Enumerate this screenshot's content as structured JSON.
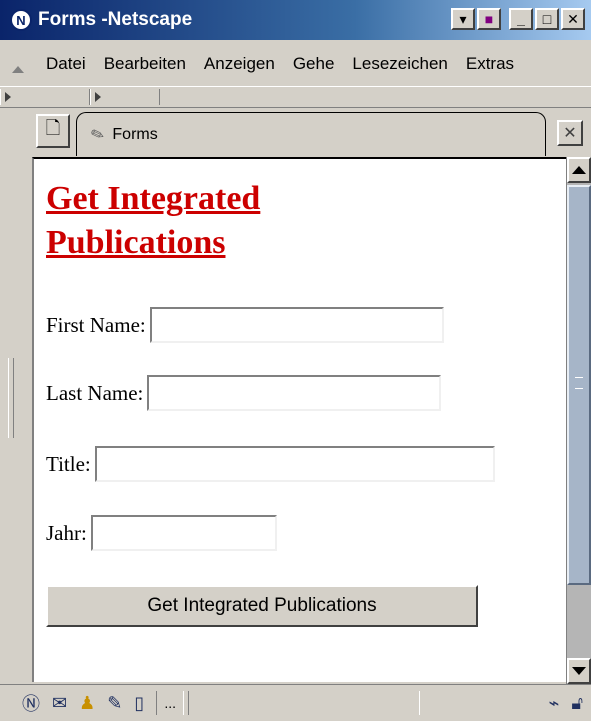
{
  "window": {
    "title": "Forms -Netscape",
    "app_icon": "N"
  },
  "menu": {
    "items": [
      "Datei",
      "Bearbeiten",
      "Anzeigen",
      "Gehe",
      "Lesezeichen",
      "Extras"
    ]
  },
  "tabs": [
    {
      "label": "Forms"
    }
  ],
  "page": {
    "heading": "Get Integrated Publications",
    "fields": [
      {
        "label": "First Name:",
        "value": ""
      },
      {
        "label": "Last Name:",
        "value": ""
      },
      {
        "label": "Title:",
        "value": ""
      },
      {
        "label": "Jahr:",
        "value": ""
      }
    ],
    "submit_label": "Get Integrated Publications"
  },
  "statusbar": {
    "more_label": "..."
  },
  "icons": {
    "app": "netscape-icon",
    "new_tab": "new-tab-icon",
    "tab": "bookmark-tag-icon",
    "close_tab": "close-tab-icon",
    "status": [
      "navigator-icon",
      "mail-icon",
      "aim-icon",
      "composer-icon",
      "address-book-icon"
    ],
    "online": "online-plug-icon",
    "security": "lock-icon"
  }
}
